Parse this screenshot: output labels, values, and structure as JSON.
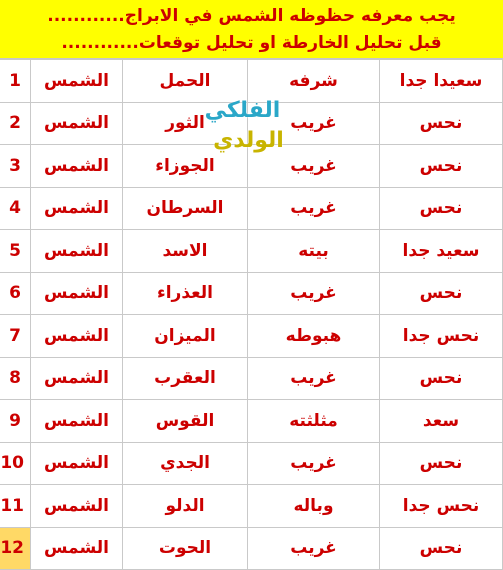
{
  "banner": {
    "line1": "يجب معرفه حظوظه الشمس في الابراج............",
    "line2": "قبل تحليل الخارطة او تحليل توقعات............"
  },
  "watermark": {
    "line1": "الفلكي",
    "line2": "الولدي"
  },
  "colors": {
    "banner_bg": "#ffff00",
    "text_red": "#cc0000",
    "row_number_bg": "#eeece1",
    "last_row_number_bg": "#ffd966",
    "grid_line": "#c9c9c9",
    "watermark_cyan": "#2aa7c8",
    "watermark_gold": "#c8b400"
  },
  "table": {
    "rows": [
      {
        "planet": "الشمس",
        "sign": "الحمل",
        "state": "شرفه",
        "result": "سعيدا جدا",
        "num": "1"
      },
      {
        "planet": "الشمس",
        "sign": "الثور",
        "state": "غريب",
        "result": "نحس",
        "num": "2"
      },
      {
        "planet": "الشمس",
        "sign": "الجوزاء",
        "state": "غريب",
        "result": "نحس",
        "num": "3"
      },
      {
        "planet": "الشمس",
        "sign": "السرطان",
        "state": "غريب",
        "result": "نحس",
        "num": "4"
      },
      {
        "planet": "الشمس",
        "sign": "الاسد",
        "state": "بيته",
        "result": "سعيد جدا",
        "num": "5"
      },
      {
        "planet": "الشمس",
        "sign": "العذراء",
        "state": "غريب",
        "result": "نحس",
        "num": "6"
      },
      {
        "planet": "الشمس",
        "sign": "الميزان",
        "state": "هبوطه",
        "result": "نحس جدا",
        "num": "7"
      },
      {
        "planet": "الشمس",
        "sign": "العقرب",
        "state": "غريب",
        "result": "نحس",
        "num": "8"
      },
      {
        "planet": "الشمس",
        "sign": "القوس",
        "state": "مثلثته",
        "result": "سعد",
        "num": "9"
      },
      {
        "planet": "الشمس",
        "sign": "الجدي",
        "state": "غريب",
        "result": "نحس",
        "num": "10"
      },
      {
        "planet": "الشمس",
        "sign": "الدلو",
        "state": "وباله",
        "result": "نحس جدا",
        "num": "11"
      },
      {
        "planet": "الشمس",
        "sign": "الحوت",
        "state": "غريب",
        "result": "نحس",
        "num": "12"
      }
    ]
  }
}
